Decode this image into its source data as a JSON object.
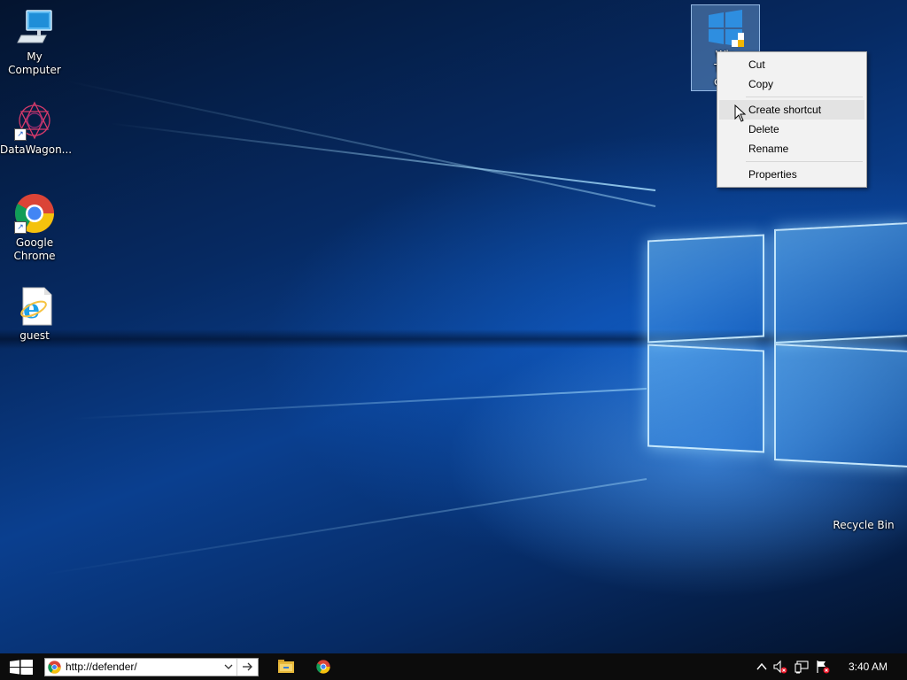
{
  "desktop": {
    "icons": [
      {
        "label": "My Computer",
        "icon": "computer-icon"
      },
      {
        "label": "DataWagon...",
        "icon": "datawagon-icon"
      },
      {
        "label": "Google\nChrome",
        "icon": "chrome-icon"
      },
      {
        "label": "guest",
        "icon": "internet-explorer-icon"
      },
      {
        "label": "Recycle Bin",
        "icon": "recycle-bin-icon"
      }
    ],
    "selected_icon": {
      "label_lines": [
        "Win",
        "Tran",
        "on P"
      ],
      "icon": "windows-update-icon"
    }
  },
  "context_menu": {
    "items": [
      "Cut",
      "Copy",
      "Create shortcut",
      "Delete",
      "Rename",
      "Properties"
    ],
    "hovered": "Create shortcut"
  },
  "taskbar": {
    "address": "http://defender/",
    "clock": "3:40 AM"
  },
  "colors": {
    "taskbar": "#0c0c0c",
    "menu_bg": "#f2f2f2",
    "menu_hover": "#e3e3e3",
    "selection": "#99ccff"
  }
}
